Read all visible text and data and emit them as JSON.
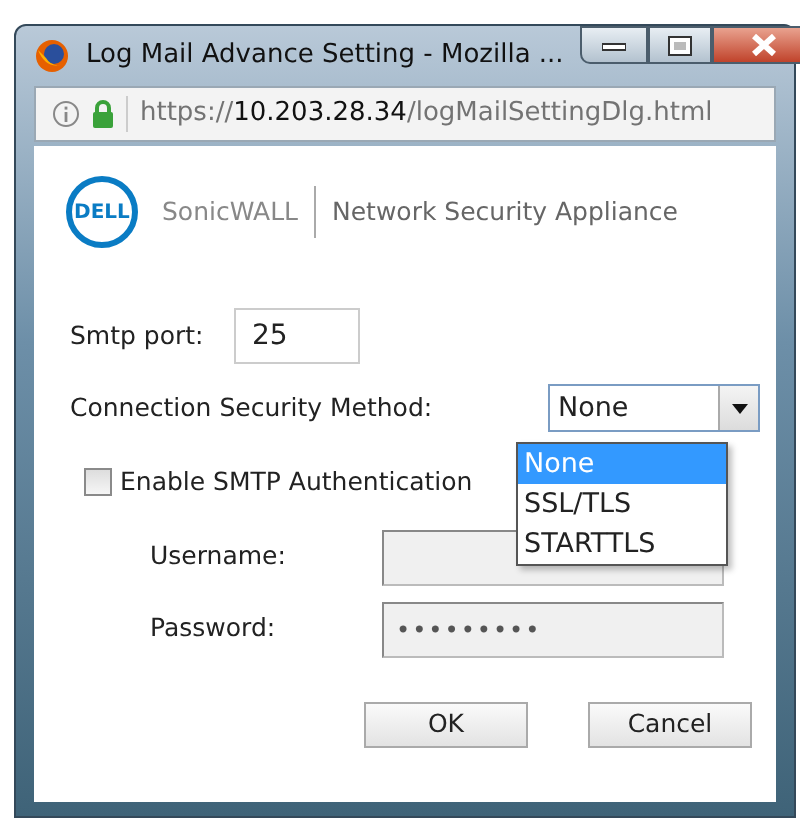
{
  "window": {
    "title": "Log Mail Advance Setting - Mozilla ..."
  },
  "address_bar": {
    "scheme": "https://",
    "host": "10.203.28.34",
    "path": "/logMailSettingDlg.html"
  },
  "header": {
    "logo": "DELL",
    "brand": "SonicWALL",
    "product": "Network Security Appliance"
  },
  "smtp_port": {
    "label": "Smtp port:",
    "value": "25"
  },
  "connection_security": {
    "label": "Connection Security Method:",
    "value": "None",
    "expanded": true,
    "options": [
      {
        "label": "None",
        "selected": true
      },
      {
        "label": "SSL/TLS",
        "selected": false
      },
      {
        "label": "STARTTLS",
        "selected": false
      }
    ]
  },
  "smtp_auth": {
    "label": "Enable SMTP Authentication",
    "checked": false
  },
  "username": {
    "label": "Username:",
    "disabled": true
  },
  "password": {
    "label": "Password:",
    "value": "•••••••••",
    "disabled": true
  },
  "buttons": [
    "OK",
    "Cancel"
  ]
}
